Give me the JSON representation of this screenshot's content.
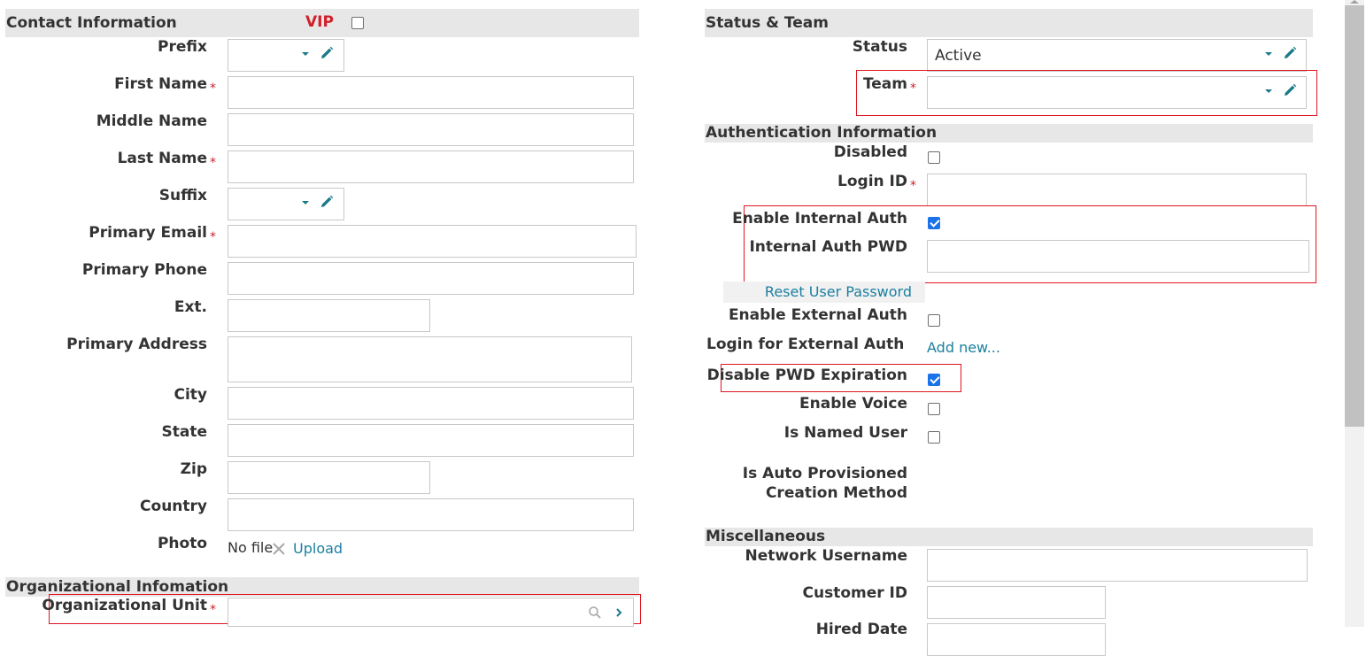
{
  "contact": {
    "section_title": "Contact Information",
    "vip_label": "VIP",
    "prefix_label": "Prefix",
    "first_name_label": "First Name",
    "middle_name_label": "Middle Name",
    "last_name_label": "Last Name",
    "suffix_label": "Suffix",
    "primary_email_label": "Primary Email",
    "primary_phone_label": "Primary Phone",
    "ext_label": "Ext.",
    "primary_address_label": "Primary Address",
    "city_label": "City",
    "state_label": "State",
    "zip_label": "Zip",
    "country_label": "Country",
    "photo_label": "Photo",
    "photo_value": "No file",
    "upload_label": "Upload",
    "required_mark": "*"
  },
  "organizational": {
    "section_title": "Organizational Infomation",
    "org_unit_label": "Organizational Unit"
  },
  "status_team": {
    "section_title": "Status & Team",
    "status_label": "Status",
    "status_value": "Active",
    "team_label": "Team"
  },
  "auth": {
    "section_title": "Authentication Information",
    "disabled_label": "Disabled",
    "login_id_label": "Login ID",
    "enable_internal_auth_label": "Enable Internal Auth",
    "internal_auth_pwd_label": "Internal Auth PWD",
    "reset_password_label": "Reset User Password",
    "enable_external_auth_label": "Enable External Auth",
    "login_external_label": "Login for External Auth",
    "add_new_label": "Add new...",
    "disable_pwd_expiration_label": "Disable PWD Expiration",
    "enable_voice_label": "Enable Voice",
    "is_named_user_label": "Is Named User",
    "is_auto_provisioned_label": "Is Auto Provisioned",
    "creation_method_label": "Creation Method"
  },
  "misc": {
    "section_title": "Miscellaneous",
    "network_username_label": "Network Username",
    "customer_id_label": "Customer ID",
    "hired_date_label": "Hired Date"
  },
  "checkboxes": {
    "vip": false,
    "disabled": false,
    "enable_internal_auth": true,
    "enable_external_auth": false,
    "disable_pwd_expiration": true,
    "enable_voice": false,
    "is_named_user": false
  },
  "colors": {
    "section_bg": "#e7e7e7",
    "required": "#d0202a",
    "accent": "#1a7a88",
    "link": "#1b7fa0",
    "checkbox_checked": "#1a73e8",
    "highlight": "#e0151f"
  }
}
